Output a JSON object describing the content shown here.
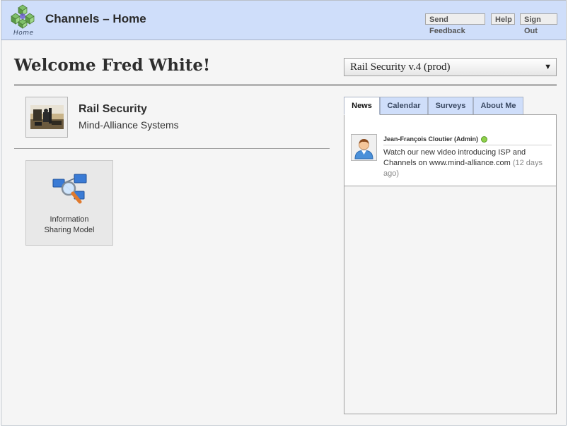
{
  "header": {
    "home_caption": "Home",
    "title": "Channels – Home",
    "buttons": {
      "send_feedback": "Send Feedback",
      "help": "Help",
      "sign_out": "Sign Out"
    },
    "background_color": "#cfdefa"
  },
  "welcome": "Welcome Fred White!",
  "plan_selector": {
    "selected": "Rail Security v.4 (prod)"
  },
  "organization": {
    "name": "Rail Security",
    "company": "Mind-Alliance Systems"
  },
  "tiles": [
    {
      "label_line1": "Information",
      "label_line2": "Sharing Model",
      "icon": "information-sharing-model-icon"
    }
  ],
  "tabs": [
    {
      "label": "News",
      "active": true
    },
    {
      "label": "Calendar",
      "active": false
    },
    {
      "label": "Surveys",
      "active": false
    },
    {
      "label": "About Me",
      "active": false
    }
  ],
  "news": [
    {
      "author": "Jean-François Cloutier (Admin)",
      "online": true,
      "message": "Watch our new video introducing ISP and Channels on www.mind-alliance.com",
      "time": "(12 days ago)"
    }
  ]
}
